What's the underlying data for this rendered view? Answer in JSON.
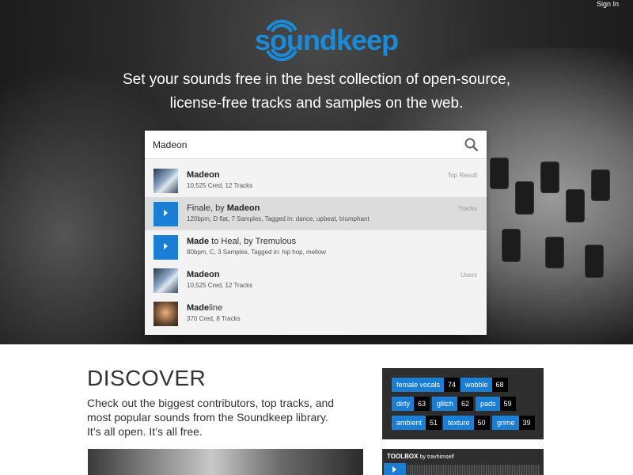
{
  "header": {
    "sign_in": "Sign In",
    "logo_text": "soundkeep",
    "tagline_line1": "Set your sounds free in the best collection of open-source,",
    "tagline_line2": "license-free tracks and samples on the web."
  },
  "search": {
    "value": "Madeon",
    "icon": "search-icon",
    "results": [
      {
        "title_bold": "Madeon",
        "title_rest": "",
        "subtitle": "10,525 Cred, 12 Tracks",
        "category": "Top Result",
        "thumb": "avatar-image"
      },
      {
        "title_pre": "Finale, by ",
        "title_bold": "Madeon",
        "subtitle": "120bpm, D flat, 7 Samples, Tagged in: dance, upbeat, triumphant",
        "category": "Tracks",
        "thumb": "play-icon"
      },
      {
        "title_bold": "Made",
        "title_rest": " to Heal, by Tremulous",
        "subtitle": "80bpm, C, 3 Samples, Tagged in: hip hop, mellow",
        "category": "",
        "thumb": "play-icon"
      },
      {
        "title_bold": "Madeon",
        "title_rest": "",
        "subtitle": "10,525 Cred, 12 Tracks",
        "category": "Users",
        "thumb": "avatar-image"
      },
      {
        "title_bold": "Made",
        "title_rest": "line",
        "subtitle": "370 Cred, 8 Tracks",
        "category": "",
        "thumb": "avatar-image"
      }
    ]
  },
  "discover": {
    "title": "DISCOVER",
    "text_line1": "Check out the biggest contributors, top tracks, and",
    "text_line2": "most popular sounds from the Soundkeep library.",
    "text_line3": "It’s all open. It’s all free."
  },
  "tags": [
    {
      "label": "female vocals",
      "count": "74"
    },
    {
      "label": "wobble",
      "count": "68"
    },
    {
      "label": "dirty",
      "count": "63"
    },
    {
      "label": "glitch",
      "count": "62"
    },
    {
      "label": "pads",
      "count": "59"
    },
    {
      "label": "ambient",
      "count": "51"
    },
    {
      "label": "texture",
      "count": "50"
    },
    {
      "label": "grime",
      "count": "39"
    }
  ],
  "toolbox": {
    "title": "TOOLBOX",
    "by": "by travhimself"
  },
  "colors": {
    "accent": "#1a7fd4",
    "logo": "#1a8bd8",
    "dark_panel": "#2e2e2e"
  }
}
